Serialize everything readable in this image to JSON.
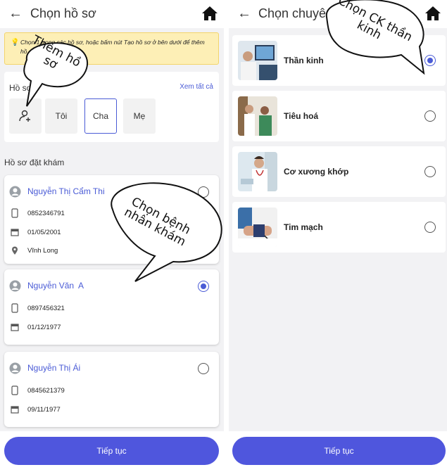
{
  "left": {
    "title": "Chọn hồ sơ",
    "notice": "Chọn 1 trong các hồ sơ, hoặc bấm nút Tạo hồ sơ ở bên dưới để thêm hồ sơ khám",
    "profiles_label": "Hồ sơ",
    "see_all": "Xem tất cả",
    "profile_buttons": [
      "Tôi",
      "Cha",
      "Mẹ"
    ],
    "selected_profile": "Cha",
    "patients_title": "Hồ sơ đặt khám",
    "patients": [
      {
        "name": "Nguyễn Thị Cẩm Thi",
        "phone": "0852346791",
        "dob": "01/05/2001",
        "address": "Vĩnh Long",
        "selected": false
      },
      {
        "name": "Nguyễn Văn  A",
        "phone": "0897456321",
        "dob": "01/12/1977",
        "selected": true
      },
      {
        "name": "Nguyễn Thị Ái",
        "phone": "0845621379",
        "dob": "09/11/1977",
        "selected": false
      }
    ],
    "continue_label": "Tiếp tục"
  },
  "right": {
    "title": "Chọn chuyên khoa",
    "specialties": [
      {
        "name": "Thần kinh",
        "selected": true
      },
      {
        "name": "Tiêu hoá",
        "selected": false
      },
      {
        "name": "Cơ xương khớp",
        "selected": false
      },
      {
        "name": "Tim mạch",
        "selected": false
      }
    ],
    "continue_label": "Tiếp tục"
  },
  "annotations": {
    "add_profile": [
      "Thêm hồ",
      "sơ"
    ],
    "choose_patient": [
      "Chọn bệnh",
      "nhân khám"
    ],
    "choose_specialty": [
      "Chọn CK thần",
      "kinh"
    ]
  },
  "colors": {
    "accent": "#4a5bd6",
    "button": "#4f56dd",
    "notice_bg": "#fdefb6",
    "background": "#f2f2f4"
  }
}
